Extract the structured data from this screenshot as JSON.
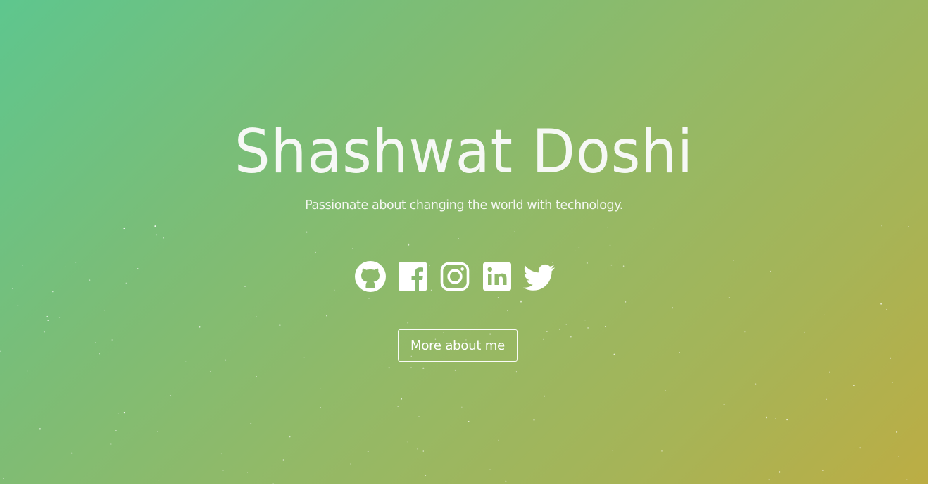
{
  "hero": {
    "name": "Shashwat Doshi",
    "tagline": "Passionate about changing the world with technology.",
    "cta_label": "More about me",
    "background_colors": [
      "#5ec68e",
      "#94b966",
      "#bcad44"
    ],
    "text_color": "#ffffff"
  },
  "socials": [
    {
      "icon": "github-icon"
    },
    {
      "icon": "facebook-icon"
    },
    {
      "icon": "instagram-icon"
    },
    {
      "icon": "linkedin-icon"
    },
    {
      "icon": "twitter-icon"
    }
  ]
}
